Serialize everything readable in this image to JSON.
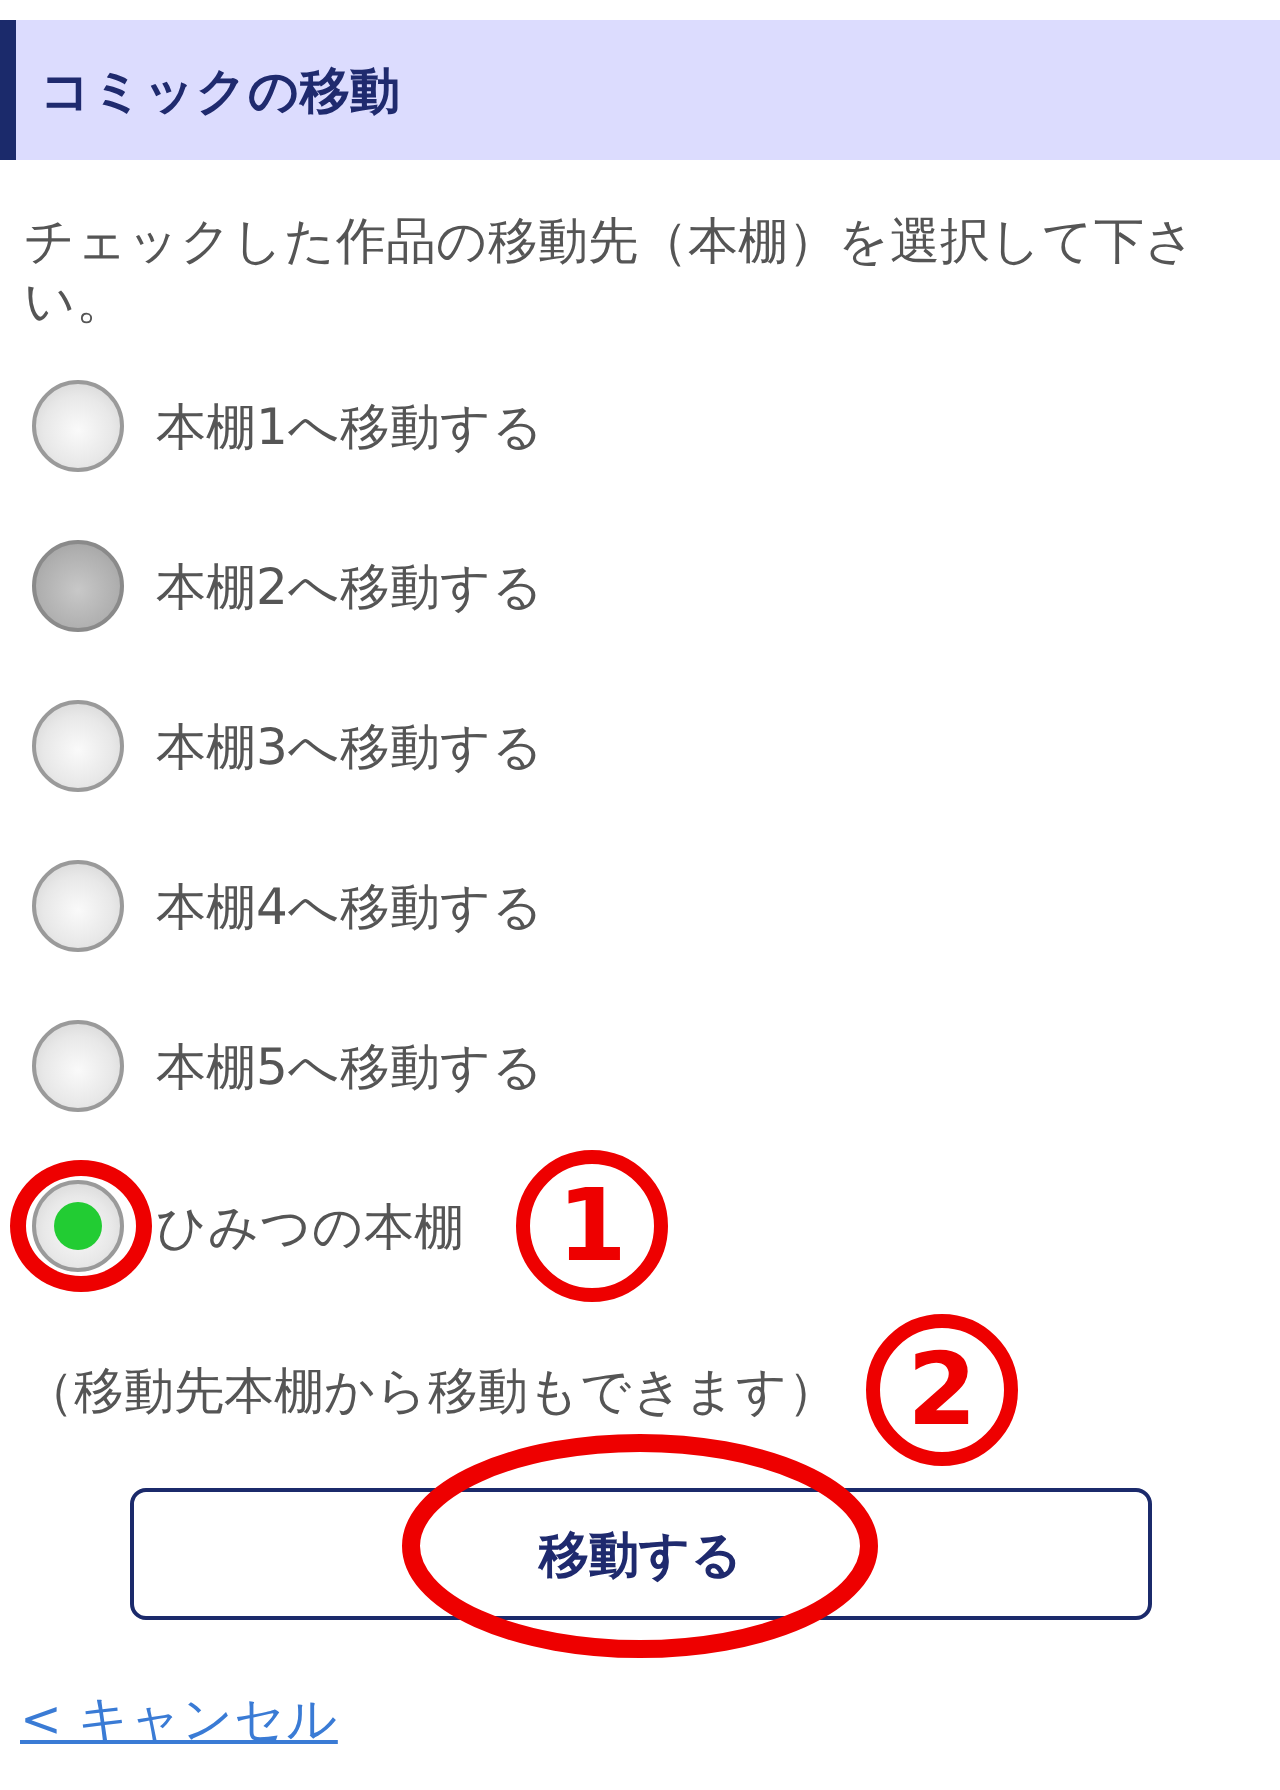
{
  "header": {
    "title": "コミックの移動"
  },
  "description": "チェックした作品の移動先（本棚）を選択して下さい。",
  "options": [
    {
      "label": "本棚1へ移動する",
      "selected": false,
      "disabled": false,
      "highlighted": false
    },
    {
      "label": "本棚2へ移動する",
      "selected": false,
      "disabled": true,
      "highlighted": false
    },
    {
      "label": "本棚3へ移動する",
      "selected": false,
      "disabled": false,
      "highlighted": false
    },
    {
      "label": "本棚4へ移動する",
      "selected": false,
      "disabled": false,
      "highlighted": false
    },
    {
      "label": "本棚5へ移動する",
      "selected": false,
      "disabled": false,
      "highlighted": false
    },
    {
      "label": "ひみつの本棚",
      "selected": true,
      "disabled": false,
      "highlighted": true,
      "step": "1"
    }
  ],
  "note": {
    "text": "（移動先本棚から移動もできます）",
    "step": "2"
  },
  "move_button": {
    "label": "移動する",
    "highlighted": true
  },
  "cancel_link": {
    "label": "< キャンセル"
  }
}
